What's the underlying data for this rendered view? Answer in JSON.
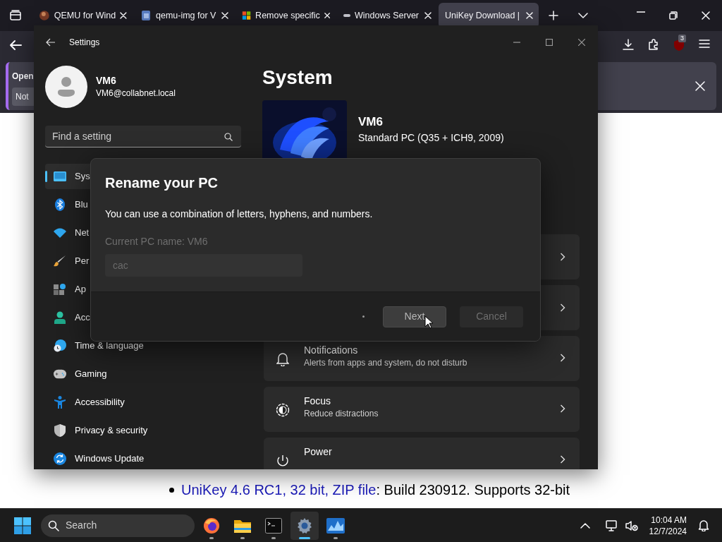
{
  "browser": {
    "tabs": [
      {
        "title": "QEMU for Wind",
        "selected": false
      },
      {
        "title": "qemu-img for V",
        "selected": false
      },
      {
        "title": "Remove specific",
        "selected": false
      },
      {
        "title": "Windows Server",
        "selected": false
      },
      {
        "title": "UniKey Download |",
        "selected": true
      }
    ],
    "notification": {
      "message": "Open",
      "button": "Not"
    },
    "extension_badge": "3"
  },
  "page": {
    "link": "UniKey 4.6 RC1, 32 bit, ZIP file",
    "text": ": Build 230912. Supports 32-bit"
  },
  "settings": {
    "title": "Settings",
    "user": {
      "name": "VM6",
      "email": "VM6@collabnet.local"
    },
    "search": {
      "placeholder": "Find a setting"
    },
    "nav": [
      {
        "label": "Sys",
        "selected": true
      },
      {
        "label": "Blu",
        "selected": false
      },
      {
        "label": "Net",
        "selected": false
      },
      {
        "label": "Per",
        "selected": false
      },
      {
        "label": "Ap",
        "selected": false
      },
      {
        "label": "Acc",
        "selected": false
      },
      {
        "label": "Time & language",
        "selected": false
      },
      {
        "label": "Gaming",
        "selected": false
      },
      {
        "label": "Accessibility",
        "selected": false
      },
      {
        "label": "Privacy & security",
        "selected": false
      },
      {
        "label": "Windows Update",
        "selected": false
      }
    ],
    "heading": "System",
    "pc": {
      "name": "VM6",
      "model": "Standard PC (Q35 + ICH9, 2009)"
    },
    "cards": [
      {
        "title": "Notifications",
        "subtitle": "Alerts from apps and system, do not disturb"
      },
      {
        "title": "Focus",
        "subtitle": "Reduce distractions"
      },
      {
        "title": "Power"
      }
    ]
  },
  "dialog": {
    "title": "Rename your PC",
    "description": "You can use a combination of letters, hyphens, and numbers.",
    "label": "Current PC name: VM6",
    "input": {
      "value": "cac",
      "disabled": true
    },
    "buttons": [
      {
        "label": "Next",
        "disabled": false
      },
      {
        "label": "Cancel",
        "disabled": true
      }
    ]
  },
  "taskbar": {
    "search": {
      "placeholder": "Search"
    },
    "apps": [
      {
        "kind": "firefox",
        "selected": false
      },
      {
        "kind": "files",
        "selected": false
      },
      {
        "kind": "terminal",
        "selected": false
      },
      {
        "kind": "settings",
        "selected": true
      },
      {
        "kind": "monitor",
        "selected": false
      }
    ],
    "time": "10:04 AM",
    "date": "12/7/2024"
  }
}
